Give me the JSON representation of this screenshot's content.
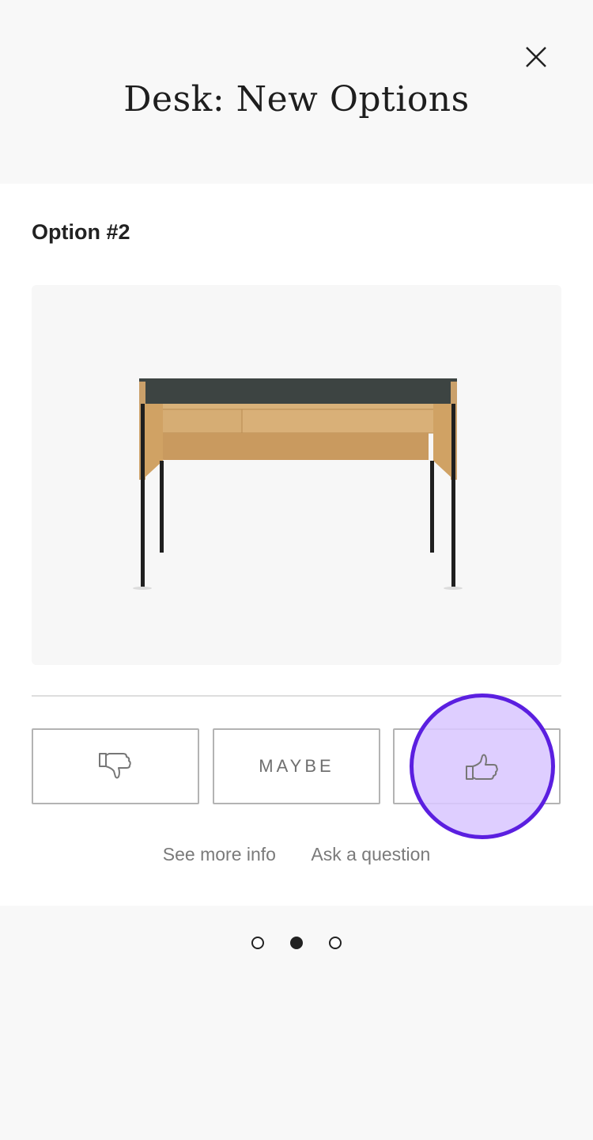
{
  "header": {
    "title": "Desk: New Options"
  },
  "option": {
    "label": "Option #2"
  },
  "actions": {
    "maybe_label": "MAYBE",
    "selected": "like"
  },
  "links": {
    "see_more": "See more info",
    "ask_question": "Ask a question"
  },
  "pagination": {
    "total": 3,
    "current": 2
  },
  "colors": {
    "highlight_border": "#5b1fe0",
    "highlight_fill": "#dac7ff"
  }
}
